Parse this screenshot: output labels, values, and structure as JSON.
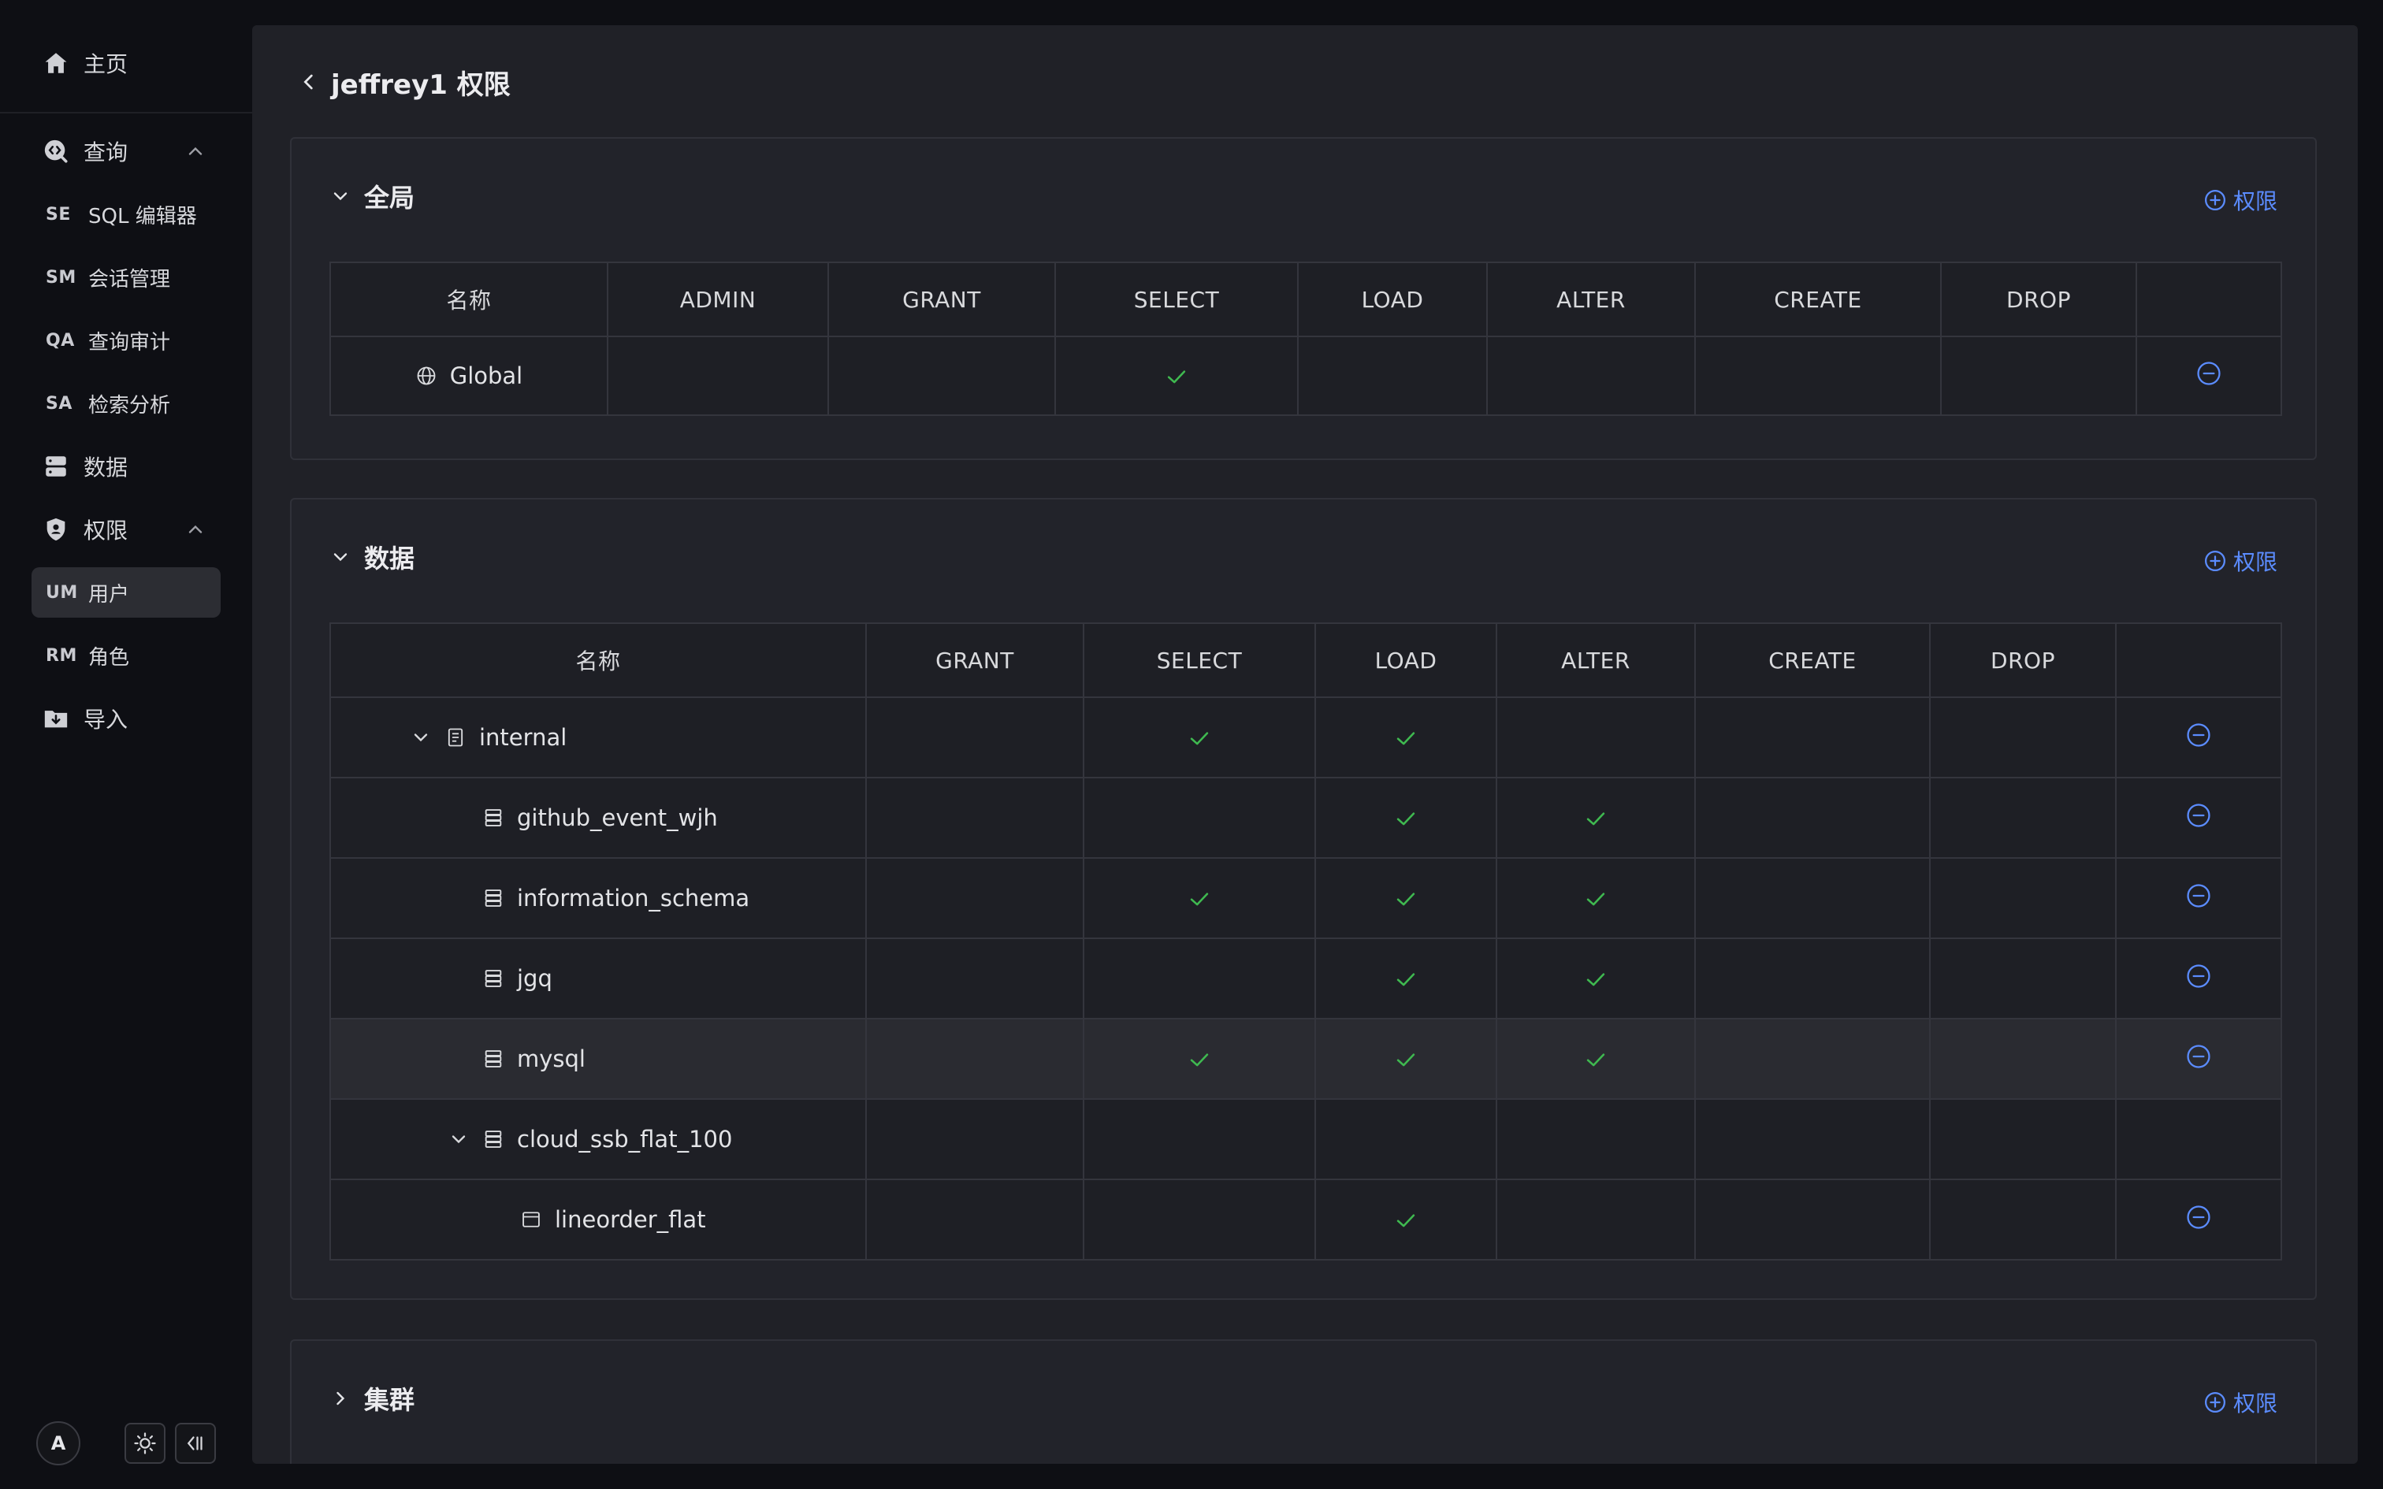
{
  "sidebar": {
    "home_label": "主页",
    "query_label": "查询",
    "query_items": [
      {
        "abbr": "SE",
        "label": "SQL 编辑器"
      },
      {
        "abbr": "SM",
        "label": "会话管理"
      },
      {
        "abbr": "QA",
        "label": "查询审计"
      },
      {
        "abbr": "SA",
        "label": "检索分析"
      }
    ],
    "data_label": "数据",
    "permission_label": "权限",
    "permission_items": [
      {
        "abbr": "UM",
        "label": "用户",
        "active": true
      },
      {
        "abbr": "RM",
        "label": "角色"
      }
    ],
    "import_label": "导入",
    "avatar_letter": "A"
  },
  "page": {
    "title": "jeffrey1 权限"
  },
  "add_permission_label": "权限",
  "global_section": {
    "title": "全局",
    "columns": [
      "名称",
      "ADMIN",
      "GRANT",
      "SELECT",
      "LOAD",
      "ALTER",
      "CREATE",
      "DROP",
      ""
    ],
    "rows": [
      {
        "name": "Global",
        "icon": "globe-icon",
        "ADMIN": false,
        "GRANT": false,
        "SELECT": true,
        "LOAD": false,
        "ALTER": false,
        "CREATE": false,
        "DROP": false,
        "removable": true
      }
    ]
  },
  "data_section": {
    "title": "数据",
    "columns": [
      "名称",
      "GRANT",
      "SELECT",
      "LOAD",
      "ALTER",
      "CREATE",
      "DROP",
      ""
    ],
    "rows": [
      {
        "name": "internal",
        "icon": "catalog-icon",
        "level": 0,
        "expandable": true,
        "GRANT": false,
        "SELECT": true,
        "LOAD": true,
        "ALTER": false,
        "CREATE": false,
        "DROP": false,
        "removable": true
      },
      {
        "name": "github_event_wjh",
        "icon": "database-icon",
        "level": 1,
        "GRANT": false,
        "SELECT": false,
        "LOAD": true,
        "ALTER": true,
        "CREATE": false,
        "DROP": false,
        "removable": true
      },
      {
        "name": "information_schema",
        "icon": "database-icon",
        "level": 1,
        "GRANT": false,
        "SELECT": true,
        "LOAD": true,
        "ALTER": true,
        "CREATE": false,
        "DROP": false,
        "removable": true
      },
      {
        "name": "jgq",
        "icon": "database-icon",
        "level": 1,
        "GRANT": false,
        "SELECT": false,
        "LOAD": true,
        "ALTER": true,
        "CREATE": false,
        "DROP": false,
        "removable": true
      },
      {
        "name": "mysql",
        "icon": "database-icon",
        "level": 1,
        "GRANT": false,
        "SELECT": true,
        "LOAD": true,
        "ALTER": true,
        "CREATE": false,
        "DROP": false,
        "removable": true,
        "hovered": true
      },
      {
        "name": "cloud_ssb_flat_100",
        "icon": "database-icon",
        "level": 1,
        "expandable": true,
        "GRANT": false,
        "SELECT": false,
        "LOAD": false,
        "ALTER": false,
        "CREATE": false,
        "DROP": false,
        "removable": false
      },
      {
        "name": "lineorder_flat",
        "icon": "table-icon",
        "level": 2,
        "GRANT": false,
        "SELECT": false,
        "LOAD": true,
        "ALTER": false,
        "CREATE": false,
        "DROP": false,
        "removable": true
      }
    ]
  },
  "cluster_section": {
    "title": "集群"
  },
  "colors": {
    "accent": "#5b8cff",
    "check": "#3fb950",
    "background": "#0e0f14",
    "panel": "#202127"
  }
}
